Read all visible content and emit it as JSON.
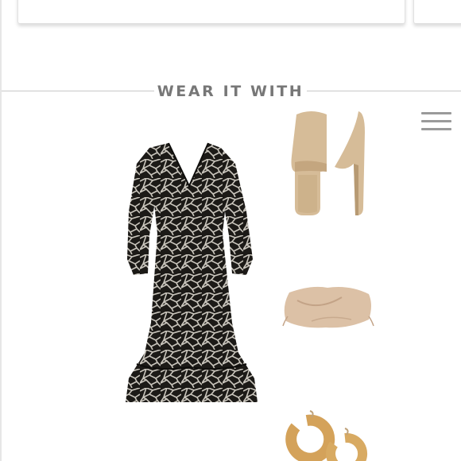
{
  "section": {
    "title": "WEAR IT WITH"
  },
  "navigation": {
    "menu_icon": "hamburger-menu-icon"
  },
  "outfit": {
    "items": [
      {
        "name": "giraffe-print-midi-dress",
        "icon": "dress-image"
      },
      {
        "name": "tan-suede-mules",
        "icon": "shoes-image"
      },
      {
        "name": "blush-pouch-clutch",
        "icon": "clutch-image"
      },
      {
        "name": "gold-hoop-earrings",
        "icon": "earrings-image"
      }
    ]
  },
  "colors": {
    "heading_text": "#777777",
    "divider": "#c8c8c8",
    "menu_icon": "#9a9a9a",
    "dress_base": "#1c1a17",
    "dress_print": "#c9c5bc",
    "mules": "#d6bc98",
    "clutch": "#dcc1a6",
    "earrings": "#d4a25a"
  }
}
